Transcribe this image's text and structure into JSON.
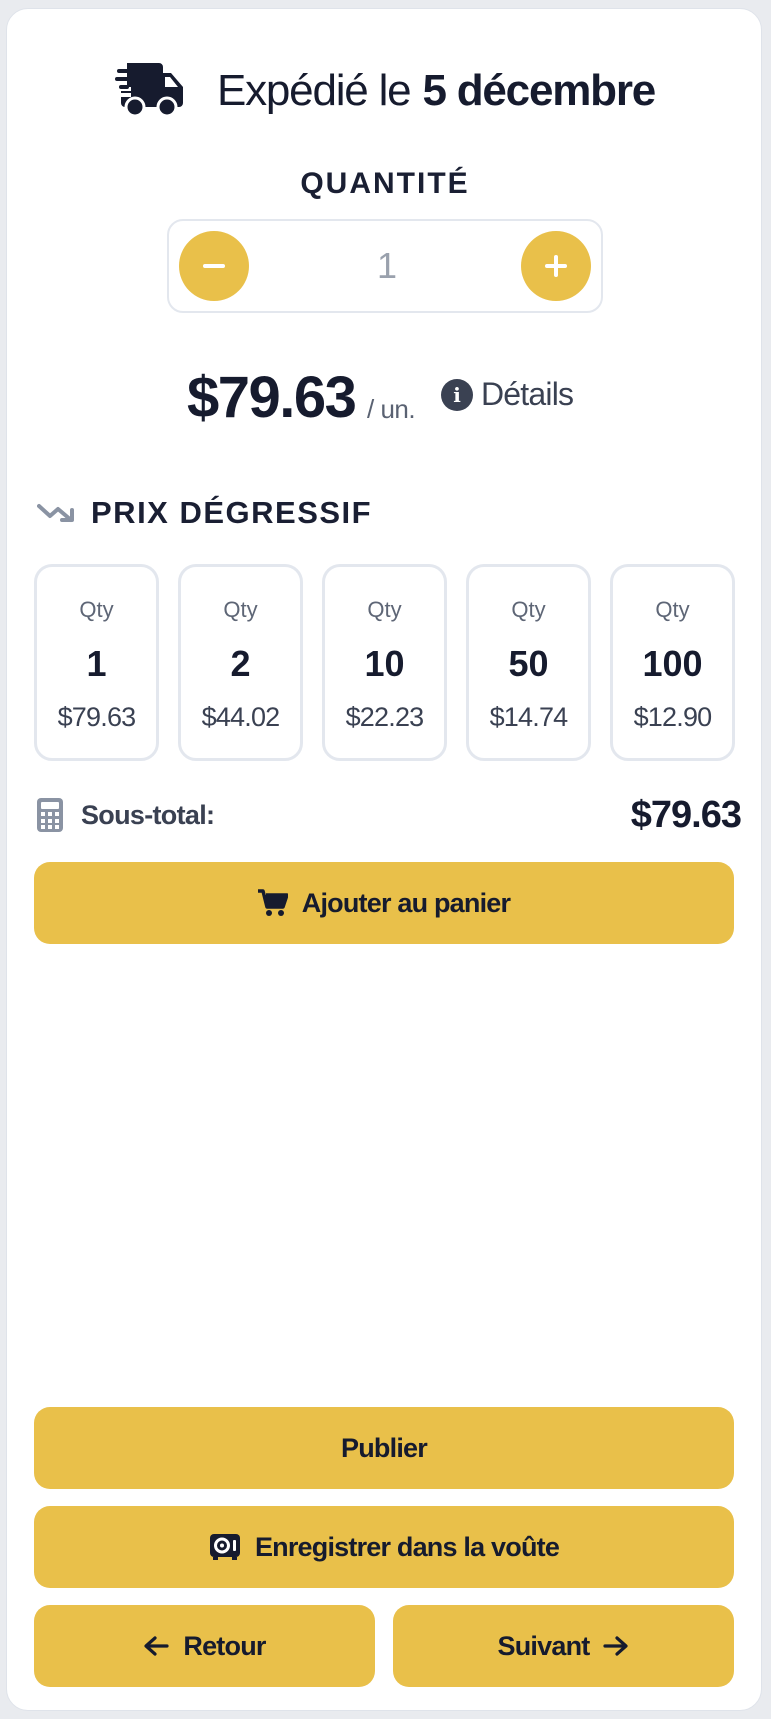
{
  "shipping": {
    "prefix": "Expédié le",
    "date": "5 décembre",
    "icon": "truck-fast-icon"
  },
  "quantity": {
    "title": "QUANTITÉ",
    "value": "1",
    "decrement_icon": "minus-icon",
    "increment_icon": "plus-icon"
  },
  "price": {
    "amount": "$79.63",
    "unit": "/ un.",
    "details_label": "Détails",
    "details_icon": "info-circle-icon"
  },
  "tiered_pricing": {
    "title": "PRIX DÉGRESSIF",
    "icon": "trend-down-icon",
    "tiers": [
      {
        "label": "Qty",
        "qty": "1",
        "price": "$79.63"
      },
      {
        "label": "Qty",
        "qty": "2",
        "price": "$44.02"
      },
      {
        "label": "Qty",
        "qty": "10",
        "price": "$22.23"
      },
      {
        "label": "Qty",
        "qty": "50",
        "price": "$14.74"
      },
      {
        "label": "Qty",
        "qty": "100",
        "price": "$12.90"
      }
    ]
  },
  "subtotal": {
    "label": "Sous-total:",
    "value": "$79.63",
    "icon": "calculator-icon"
  },
  "actions": {
    "add_to_cart": "Ajouter au panier",
    "publish": "Publier",
    "save_vault": "Enregistrer dans la voûte",
    "back": "Retour",
    "next": "Suivant"
  },
  "colors": {
    "accent": "#e9c04a",
    "text": "#161b2e",
    "muted": "#3a4152",
    "border": "#e3e7ee"
  }
}
